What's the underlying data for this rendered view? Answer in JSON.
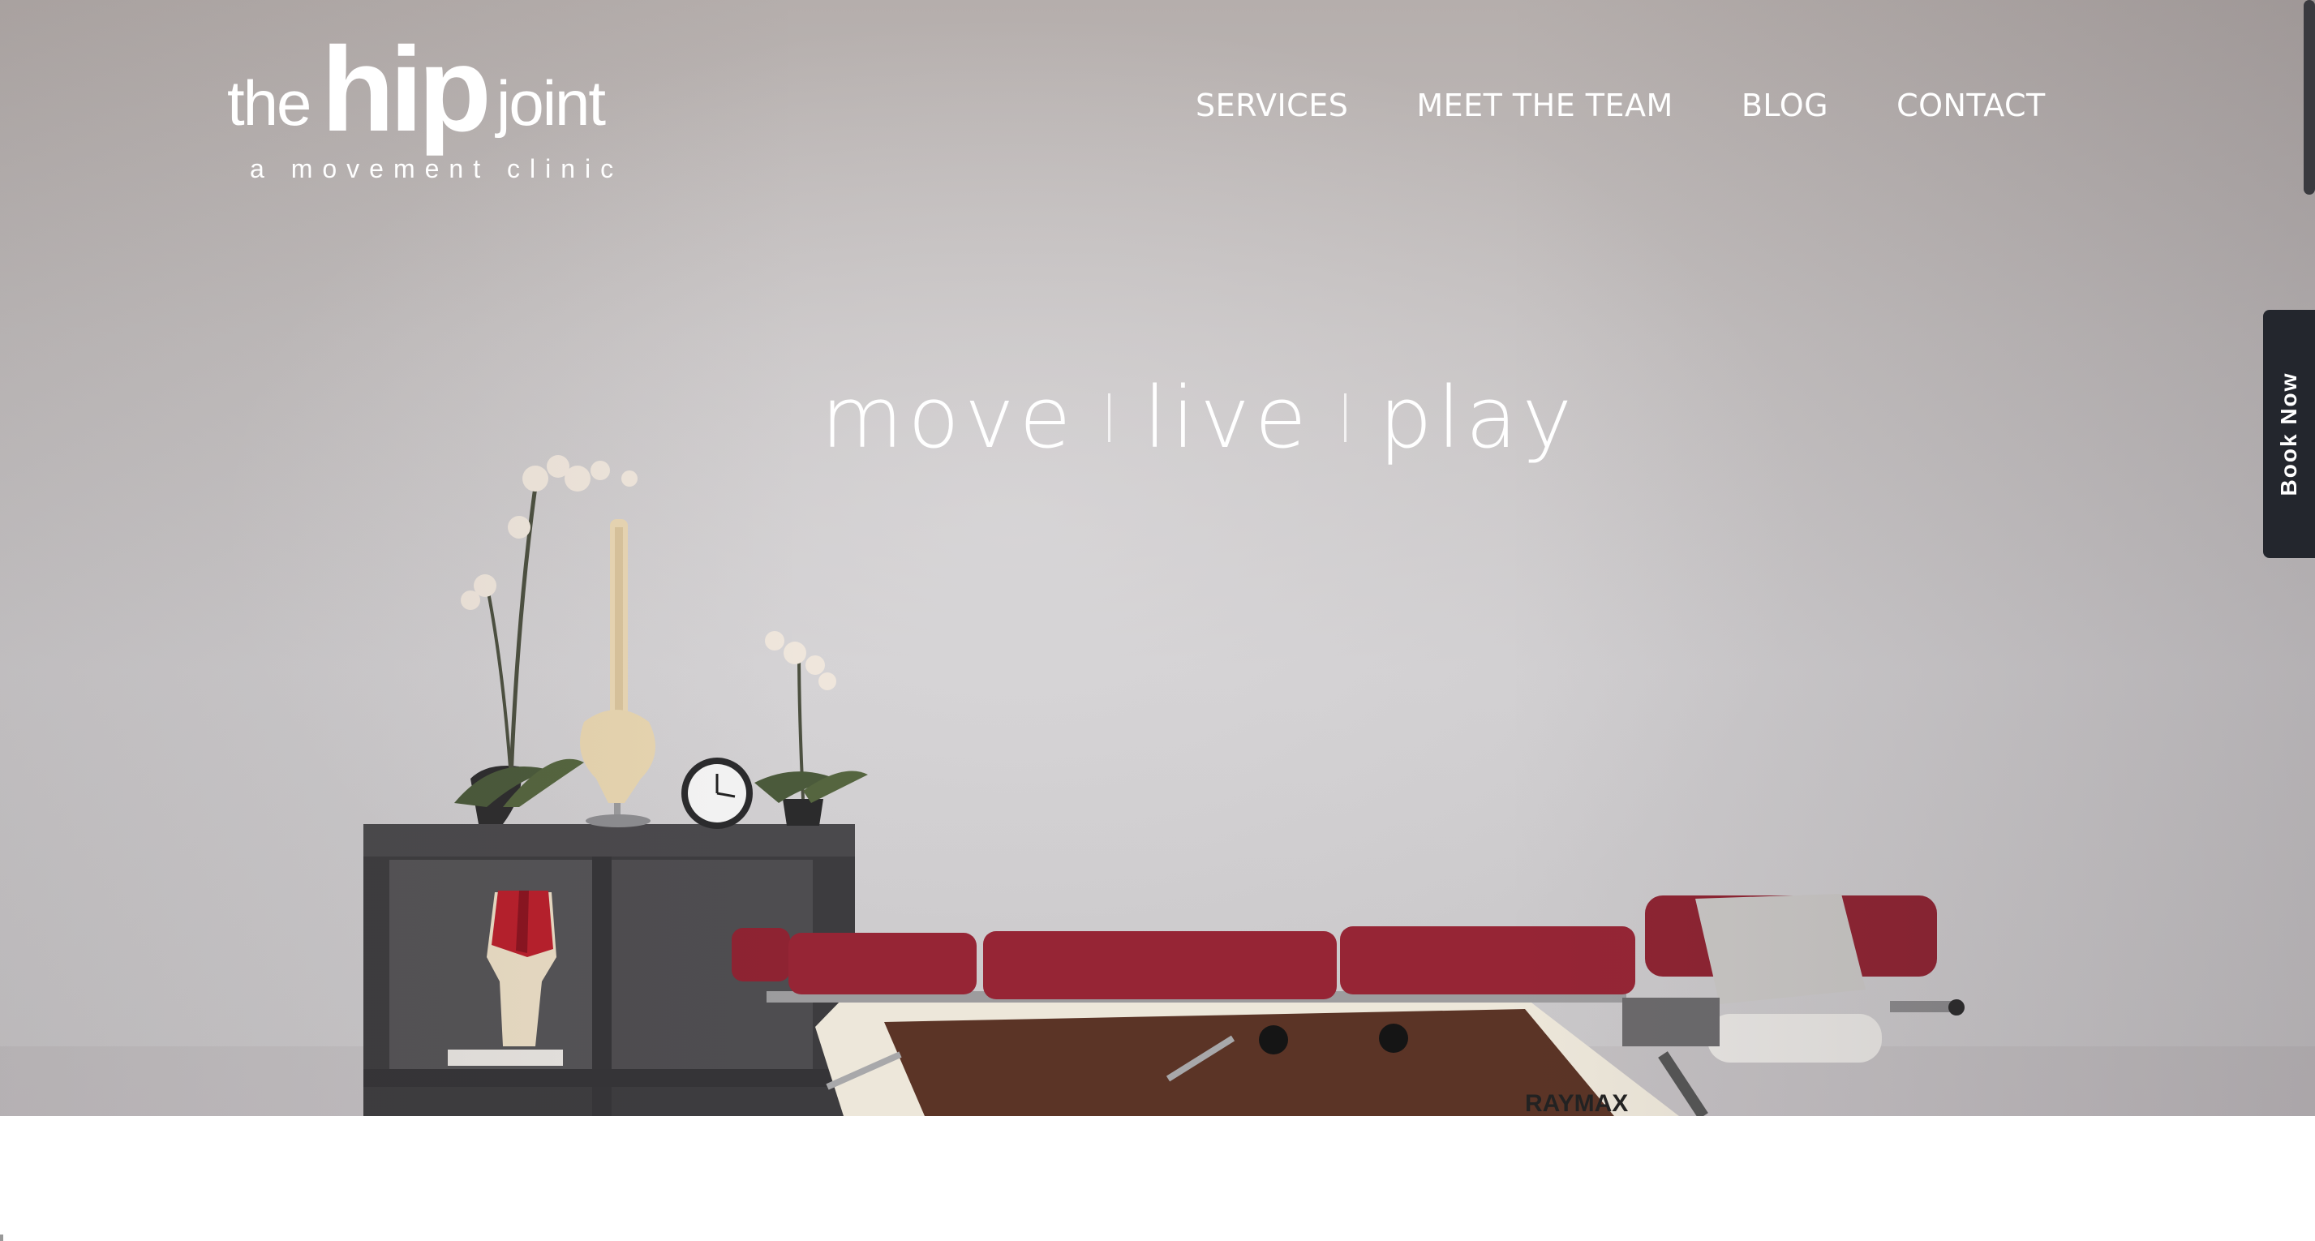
{
  "logo": {
    "word_the": "the",
    "word_hip": "hip",
    "word_joint": "joint",
    "tagline": "a movement clinic"
  },
  "nav": {
    "items": [
      {
        "label": "SERVICES"
      },
      {
        "label": "MEET THE TEAM"
      },
      {
        "label": "BLOG"
      },
      {
        "label": "CONTACT"
      }
    ]
  },
  "hero": {
    "words": [
      "move",
      "live",
      "play"
    ],
    "table_brand": "RAYMAX"
  },
  "book_now": {
    "label": "Book Now"
  },
  "colors": {
    "nav_text": "#ffffff",
    "book_now_bg": "#23262d",
    "table_upholstery": "#8e2332",
    "shelf": "#3f3e41"
  }
}
